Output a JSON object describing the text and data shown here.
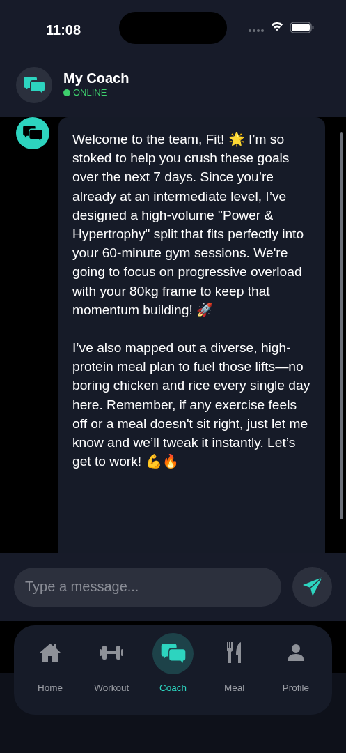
{
  "status_bar": {
    "time": "11:08"
  },
  "header": {
    "title": "My Coach",
    "status": "ONLINE",
    "online": true
  },
  "messages": [
    {
      "paragraphs": [
        "Welcome to the team, Fit! 🌟 I’m so stoked to help you crush these goals over the next 7 days. Since you’re already at an intermediate level, I’ve designed a high-volume \"Power & Hypertrophy\" split that fits perfectly into your 60-minute gym sessions. We're going to focus on progressive overload with your 80kg frame to keep that momentum building! 🚀",
        "I’ve also mapped out a diverse, high-protein meal plan to fuel those lifts—no boring chicken and rice every single day here. Remember, if any exercise feels off or a meal doesn't sit right, just let me know and we’ll tweak it instantly. Let’s get to work! 💪🔥"
      ]
    }
  ],
  "composer": {
    "placeholder": "Type a message..."
  },
  "tabs": [
    {
      "label": "Home",
      "selected": false
    },
    {
      "label": "Workout",
      "selected": false
    },
    {
      "label": "Coach",
      "selected": true
    },
    {
      "label": "Meal",
      "selected": false
    },
    {
      "label": "Profile",
      "selected": false
    }
  ]
}
